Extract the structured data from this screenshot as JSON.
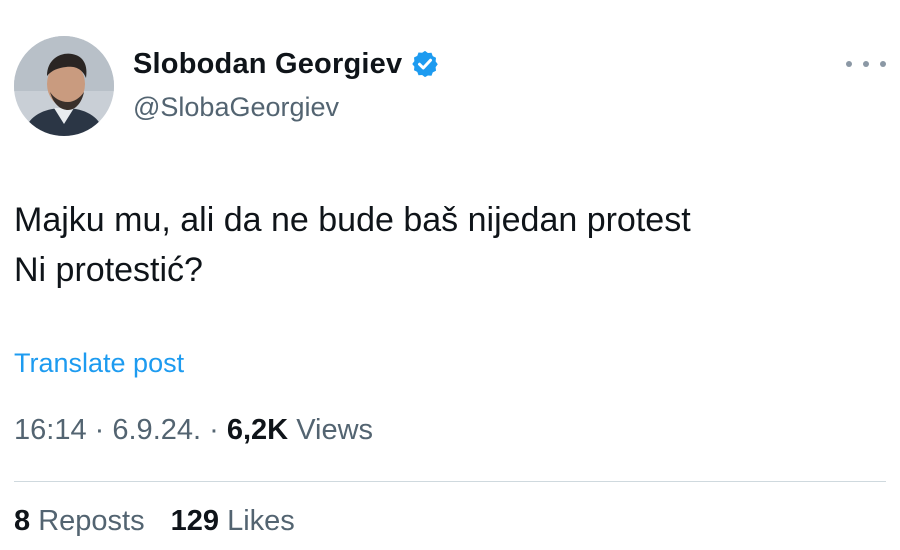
{
  "author": {
    "display_name": "Slobodan Georgiev",
    "handle": "@SlobaGeorgiev",
    "verified": true,
    "avatar_icon": "user-avatar-photo",
    "verified_icon": "verified-badge-icon",
    "verified_color": "#1d9bf0"
  },
  "more_icon": "more-options-icon",
  "post": {
    "lines": [
      "Majku mu, ali da ne bude baš nijedan protest",
      "Ni protestić?"
    ],
    "translate_label": "Translate post"
  },
  "meta": {
    "time": "16:14",
    "separator": "·",
    "date": "6.9.24.",
    "separator2": "·",
    "views_count": "6,2K",
    "views_label": "Views"
  },
  "stats": {
    "reposts_count": "8",
    "reposts_label": "Reposts",
    "likes_count": "129",
    "likes_label": "Likes"
  },
  "colors": {
    "link": "#1d9bf0",
    "secondary_text": "#536471",
    "primary_text": "#0f1419",
    "divider": "#cfd9de"
  }
}
